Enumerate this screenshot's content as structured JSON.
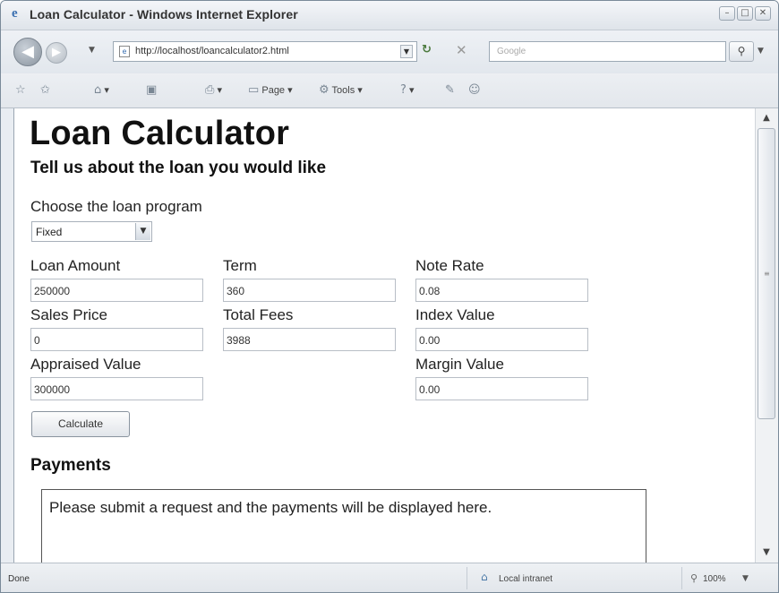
{
  "window": {
    "title": "Loan Calculator - Windows Internet Explorer",
    "minimize": "–",
    "maximize": "□",
    "close": "✕"
  },
  "nav": {
    "url": "http://localhost/loancalculator2.html",
    "search_placeholder": "Google",
    "back_glyph": "◀",
    "forward_glyph": "▶",
    "dropdown_glyph": "▼",
    "refresh_glyph": "↻",
    "stop_glyph": "✕",
    "search_glyph": "⚲"
  },
  "commandbar": {
    "page_label": "Page",
    "tools_label": "Tools"
  },
  "page": {
    "title": "Loan Calculator",
    "subtitle": "Tell us about the loan you would like",
    "program_label": "Choose the loan program",
    "program_value": "Fixed",
    "fields": {
      "loan_amount": {
        "label": "Loan Amount",
        "value": "250000"
      },
      "term": {
        "label": "Term",
        "value": "360"
      },
      "note_rate": {
        "label": "Note Rate",
        "value": "0.08"
      },
      "sales_price": {
        "label": "Sales Price",
        "value": "0"
      },
      "total_fees": {
        "label": "Total Fees",
        "value": "3988"
      },
      "index_value": {
        "label": "Index Value",
        "value": "0.00"
      },
      "appraised_value": {
        "label": "Appraised Value",
        "value": "300000"
      },
      "margin_value": {
        "label": "Margin Value",
        "value": "0.00"
      }
    },
    "calculate_label": "Calculate",
    "payments_heading": "Payments",
    "payments_message": "Please submit a request and the payments will be displayed here."
  },
  "status": {
    "text": "Done",
    "zone": "Local intranet",
    "zoom": "100%"
  },
  "icons": {
    "browser": "ie-icon",
    "favorites": "star-icon",
    "add_favorites": "add-favorites-icon",
    "feeds": "rss-icon",
    "print": "printer-icon",
    "help": "help-icon",
    "research": "research-icon",
    "messenger": "messenger-icon"
  }
}
